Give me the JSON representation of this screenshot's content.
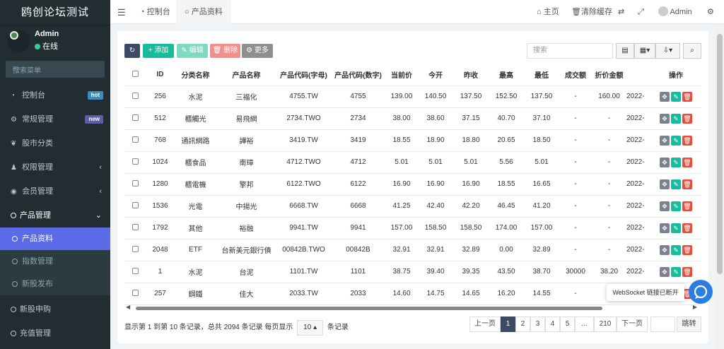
{
  "app": {
    "title": "鸥创论坛测试"
  },
  "user": {
    "name": "Admin",
    "status": "在线"
  },
  "sidebar": {
    "search_placeholder": "搜索菜单",
    "items": [
      {
        "label": "控制台",
        "icon": "dashboard-icon",
        "badge": "hot",
        "badge_color": "#3c8dbc"
      },
      {
        "label": "常规管理",
        "icon": "cogs-icon",
        "badge": "new",
        "badge_color": "#605ca8"
      },
      {
        "label": "股市分类",
        "icon": "leaf-icon"
      },
      {
        "label": "权限管理",
        "icon": "users-icon",
        "arrow": "‹"
      },
      {
        "label": "会员管理",
        "icon": "user-circle-icon",
        "arrow": "‹"
      },
      {
        "label": "产品管理",
        "icon": "circle-icon",
        "arrow": "⌄"
      }
    ],
    "subitems": [
      {
        "label": "产品资料",
        "active": true
      },
      {
        "label": "指数管理"
      },
      {
        "label": "新股发布"
      }
    ],
    "bottom_items": [
      {
        "label": "新股申购"
      },
      {
        "label": "充值管理"
      }
    ]
  },
  "topbar": {
    "tabs": [
      {
        "label": "控制台",
        "icon": "dashboard-icon"
      },
      {
        "label": "产品资料",
        "icon": "circle-icon",
        "active": true
      }
    ],
    "nav": {
      "home": "主页",
      "clear_cache": "清除缓存",
      "user": "Admin"
    }
  },
  "toolbar": {
    "refresh": "",
    "add": "添加",
    "edit": "编辑",
    "delete": "删除",
    "more": "更多",
    "search_placeholder": "搜索",
    "colors": {
      "refresh": "#3c4a66",
      "add": "#18bc9c",
      "edit": "#7fd8c0",
      "delete": "#f0908a",
      "more": "#8f8f8f"
    }
  },
  "table": {
    "headers": [
      "ID",
      "分类名称",
      "产品名称",
      "产品代码(字母)",
      "产品代码(数字)",
      "当前价",
      "今开",
      "昨收",
      "最高",
      "最低",
      "成交额",
      "折价金额",
      "",
      "操作"
    ],
    "rows": [
      [
        "256",
        "水泥",
        "三福化",
        "4755.TW",
        "4755",
        "139.00",
        "140.50",
        "137.50",
        "152.50",
        "137.50",
        "-",
        "160.00",
        "2022-"
      ],
      [
        "512",
        "櫃觸光",
        "易飛網",
        "2734.TWO",
        "2734",
        "38.00",
        "38.60",
        "37.15",
        "40.70",
        "37.10",
        "-",
        "-",
        "2022-"
      ],
      [
        "768",
        "通訊網路",
        "譁裕",
        "3419.TW",
        "3419",
        "18.55",
        "18.90",
        "18.80",
        "20.65",
        "18.50",
        "-",
        "-",
        "2022-"
      ],
      [
        "1024",
        "櫃食品",
        "南璋",
        "4712.TWO",
        "4712",
        "5.01",
        "5.01",
        "5.01",
        "5.56",
        "5.01",
        "-",
        "-",
        "2022-"
      ],
      [
        "1280",
        "櫃電機",
        "擎邦",
        "6122.TWO",
        "6122",
        "16.90",
        "16.90",
        "16.90",
        "18.55",
        "16.65",
        "-",
        "-",
        "2022-"
      ],
      [
        "1536",
        "光電",
        "中揚光",
        "6668.TW",
        "6668",
        "41.25",
        "42.40",
        "42.20",
        "46.45",
        "41.20",
        "-",
        "-",
        "2022-"
      ],
      [
        "1792",
        "其他",
        "裕融",
        "9941.TW",
        "9941",
        "157.00",
        "158.50",
        "158.50",
        "174.00",
        "157.00",
        "-",
        "-",
        "2022-"
      ],
      [
        "2048",
        "ETF",
        "台新美元銀行債",
        "00842B.TWO",
        "00842B",
        "32.91",
        "32.91",
        "32.89",
        "0.00",
        "32.89",
        "-",
        "-",
        "2022-"
      ],
      [
        "1",
        "水泥",
        "台泥",
        "1101.TW",
        "1101",
        "38.75",
        "39.40",
        "39.35",
        "43.50",
        "38.70",
        "30000",
        "38.20",
        "2022-"
      ],
      [
        "257",
        "鋼鐵",
        "佳大",
        "2033.TW",
        "2033",
        "14.60",
        "14.75",
        "14.65",
        "16.20",
        "14.55",
        "-",
        "",
        ""
      ]
    ]
  },
  "footer": {
    "summary": "显示第 1 到第 10 条记录，总共 2094 条记录 每页显示",
    "page_size": "10",
    "suffix": "条记录"
  },
  "pagination": {
    "prev": "上一页",
    "pages": [
      "1",
      "2",
      "3",
      "4",
      "5",
      "...",
      "210"
    ],
    "next": "下一页",
    "jump": "跳转"
  },
  "toast": {
    "text": "WebSocket 链接已断开"
  }
}
